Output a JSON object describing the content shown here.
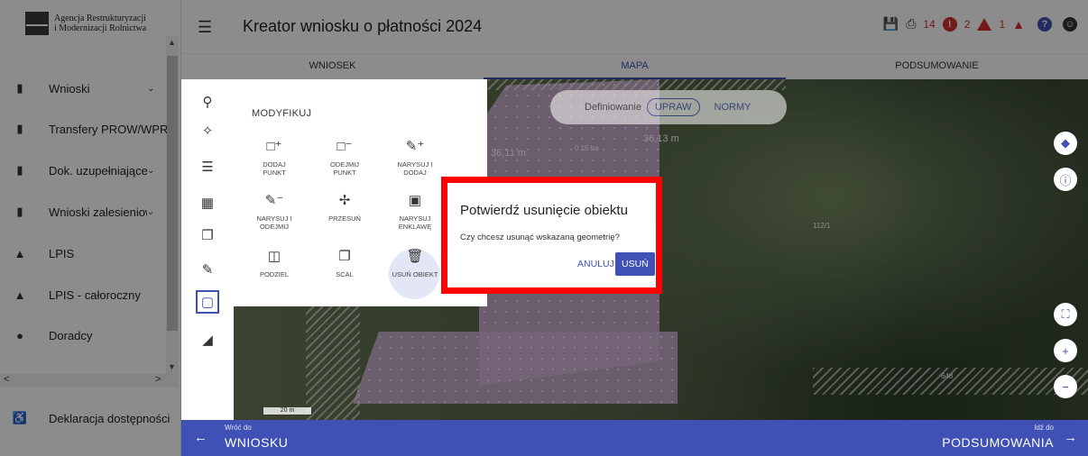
{
  "agency": {
    "line1": "Agencja Restrukturyzacji",
    "line2": "i Modernizacji Rolnictwa"
  },
  "header": {
    "title": "Kreator wniosku o płatności 2024",
    "count1": "14",
    "count2": "2",
    "count3": "1"
  },
  "sidebar": {
    "items": [
      {
        "label": "Wnioski",
        "icon": "document-icon",
        "chev": "⌄"
      },
      {
        "label": "Transfery PROW/WPR",
        "icon": "document-icon",
        "chev": ""
      },
      {
        "label": "Dok. uzupełniające",
        "icon": "document-icon",
        "chev": "⌄"
      },
      {
        "label": "Wnioski zalesieniowe",
        "icon": "document-icon",
        "chev": "⌄"
      },
      {
        "label": "LPIS",
        "icon": "mountain-icon",
        "chev": ""
      },
      {
        "label": "LPIS - całoroczny",
        "icon": "mountain-icon",
        "chev": ""
      },
      {
        "label": "Doradcy",
        "icon": "person-icon",
        "chev": ""
      }
    ],
    "bottom": "Deklaracja dostępności"
  },
  "tabs": [
    {
      "label": "WNIOSEK",
      "active": false
    },
    {
      "label": "MAPA",
      "active": true
    },
    {
      "label": "PODSUMOWANIE",
      "active": false
    }
  ],
  "panel": {
    "title": "MODYFIKUJ",
    "buttons": [
      {
        "line1": "DODAJ",
        "line2": "PUNKT"
      },
      {
        "line1": "ODEJMIJ",
        "line2": "PUNKT"
      },
      {
        "line1": "NARYSUJ I",
        "line2": "DODAJ"
      },
      {
        "line1": "NARYSUJ I",
        "line2": "ODEJMIJ"
      },
      {
        "line1": "PRZESUŃ",
        "line2": ""
      },
      {
        "line1": "NARYSUJ",
        "line2": "ENKLAWĘ"
      },
      {
        "line1": "PODZIEL",
        "line2": ""
      },
      {
        "line1": "SCAL",
        "line2": ""
      },
      {
        "line1": "USUŃ OBIEKT",
        "line2": ""
      }
    ]
  },
  "map": {
    "definiowanie": "Definiowanie",
    "uprawy": "UPRAW",
    "normy": "NORMY",
    "labels": {
      "m1": "36,11 m",
      "ha": "0.15 ha",
      "m2": "36,13 m",
      "parcel": "112/1",
      "p648": "648"
    },
    "scale": "20 m"
  },
  "dialog": {
    "title": "Potwierdź usunięcie obiektu",
    "message": "Czy chcesz usunąć wskazaną geometrię?",
    "cancel": "ANULUJ",
    "ok": "USUŃ"
  },
  "footer": {
    "back_small": "Wróć do",
    "back_big": "WNIOSKU",
    "next_small": "Idź do",
    "next_big": "PODSUMOWANIA"
  },
  "colors": {
    "primary": "#3f51b5",
    "alert": "#d32f2f",
    "dialog_frame": "#ff0000"
  }
}
